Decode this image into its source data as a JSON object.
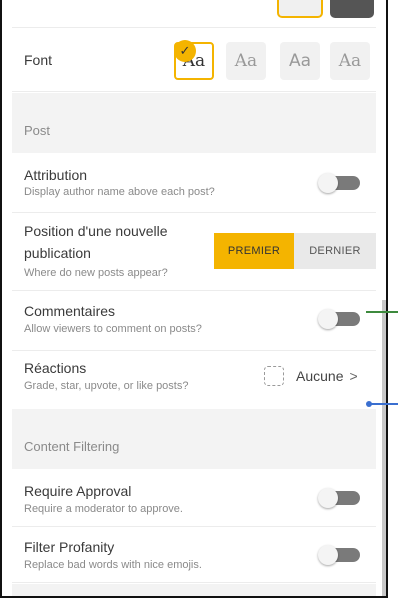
{
  "font": {
    "label": "Font",
    "options": [
      {
        "text": "Aa",
        "selected": true
      },
      {
        "text": "Aa",
        "selected": false
      },
      {
        "text": "Aa",
        "selected": false
      },
      {
        "text": "Aa",
        "selected": false
      }
    ]
  },
  "post_section": {
    "title": "Post",
    "attribution": {
      "label": "Attribution",
      "sub": "Display author name above each post?",
      "on": false
    },
    "position": {
      "label_line1": "Position d'une nouvelle",
      "label_line2": "publication",
      "sub": "Where do new posts appear?",
      "options": [
        "PREMIER",
        "DERNIER"
      ],
      "selected": "PREMIER"
    },
    "comments": {
      "label": "Commentaires",
      "sub": "Allow viewers to comment on posts?",
      "on": false
    },
    "reactions": {
      "label": "Réactions",
      "sub": "Grade, star, upvote, or like posts?",
      "value": "Aucune"
    }
  },
  "content_filtering": {
    "title": "Content Filtering",
    "require_approval": {
      "label": "Require Approval",
      "sub": "Require a moderator to approve.",
      "on": false
    },
    "filter_profanity": {
      "label": "Filter Profanity",
      "sub": "Replace bad words with nice emojis.",
      "on": false
    }
  },
  "colors": {
    "accent": "#f4b400",
    "annotation_green": "#3d8a3d",
    "annotation_blue": "#3a6fd0"
  }
}
